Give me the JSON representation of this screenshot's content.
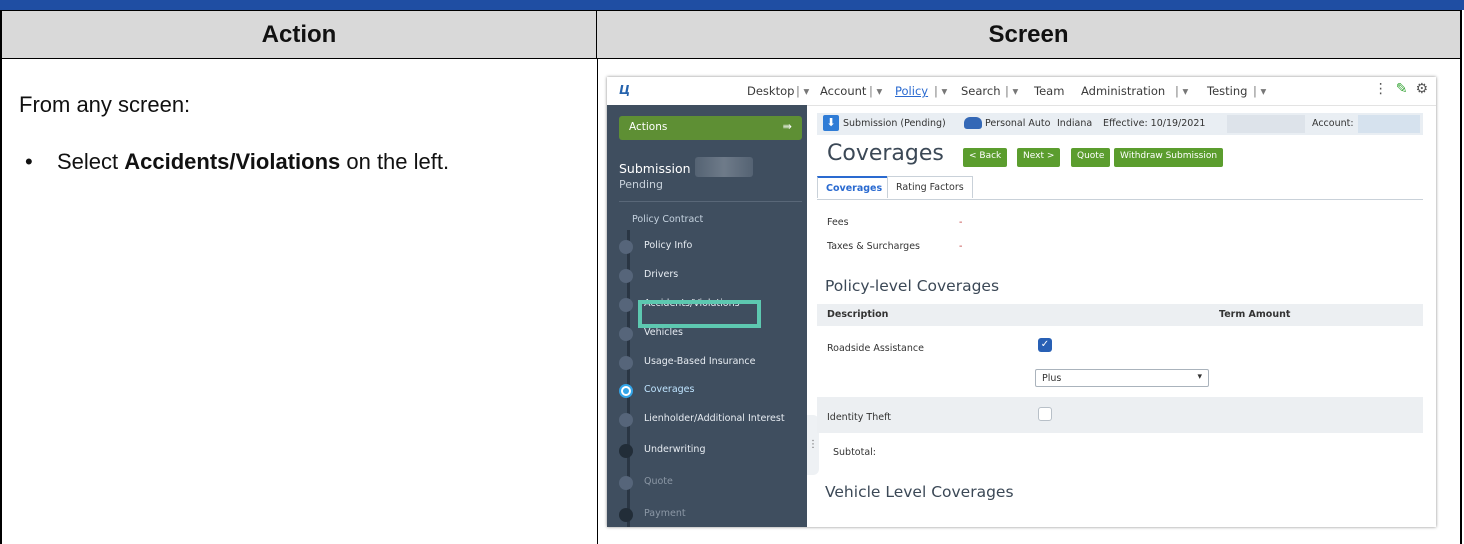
{
  "doc": {
    "header_action": "Action",
    "header_screen": "Screen",
    "intro": "From any screen:",
    "bullet_pre": "Select ",
    "bullet_bold": "Accidents/Violations",
    "bullet_post": " on the left."
  },
  "nav": {
    "desktop": "Desktop",
    "account": "Account",
    "policy": "Policy",
    "search": "Search",
    "team": "Team",
    "administration": "Administration",
    "testing": "Testing"
  },
  "sidebar": {
    "actions_label": "Actions",
    "submission_title": "Submission",
    "submission_status": "Pending",
    "items": [
      {
        "label": "Policy Contract"
      },
      {
        "label": "Policy Info"
      },
      {
        "label": "Drivers"
      },
      {
        "label": "Accidents/Violations"
      },
      {
        "label": "Vehicles"
      },
      {
        "label": "Usage-Based Insurance"
      },
      {
        "label": "Coverages"
      },
      {
        "label": "Lienholder/Additional Interest"
      },
      {
        "label": "Underwriting"
      },
      {
        "label": "Quote"
      },
      {
        "label": "Payment"
      }
    ]
  },
  "infobar": {
    "submission": "Submission (Pending)",
    "product": "Personal Auto",
    "state": "Indiana",
    "effective": "Effective: 10/19/2021",
    "account": "Account:"
  },
  "main": {
    "title": "Coverages",
    "buttons": {
      "back": "< Back",
      "next": "Next >",
      "quote": "Quote",
      "withdraw": "Withdraw Submission"
    },
    "tabs": [
      "Coverages",
      "Rating Factors"
    ],
    "fees": "Fees",
    "taxes": "Taxes & Surcharges",
    "dash": "-",
    "policy_level": "Policy-level Coverages",
    "col_description": "Description",
    "col_term_amount": "Term Amount",
    "roadside": "Roadside Assistance",
    "roadside_option": "Plus",
    "identity_theft": "Identity Theft",
    "subtotal": "Subtotal:",
    "vehicle_level": "Vehicle Level Coverages"
  },
  "colors": {
    "accent_green": "#5b9d2e",
    "highlight": "#5dc8b0",
    "sidebar": "#3f4e5f",
    "link_blue": "#2a6ad0"
  }
}
